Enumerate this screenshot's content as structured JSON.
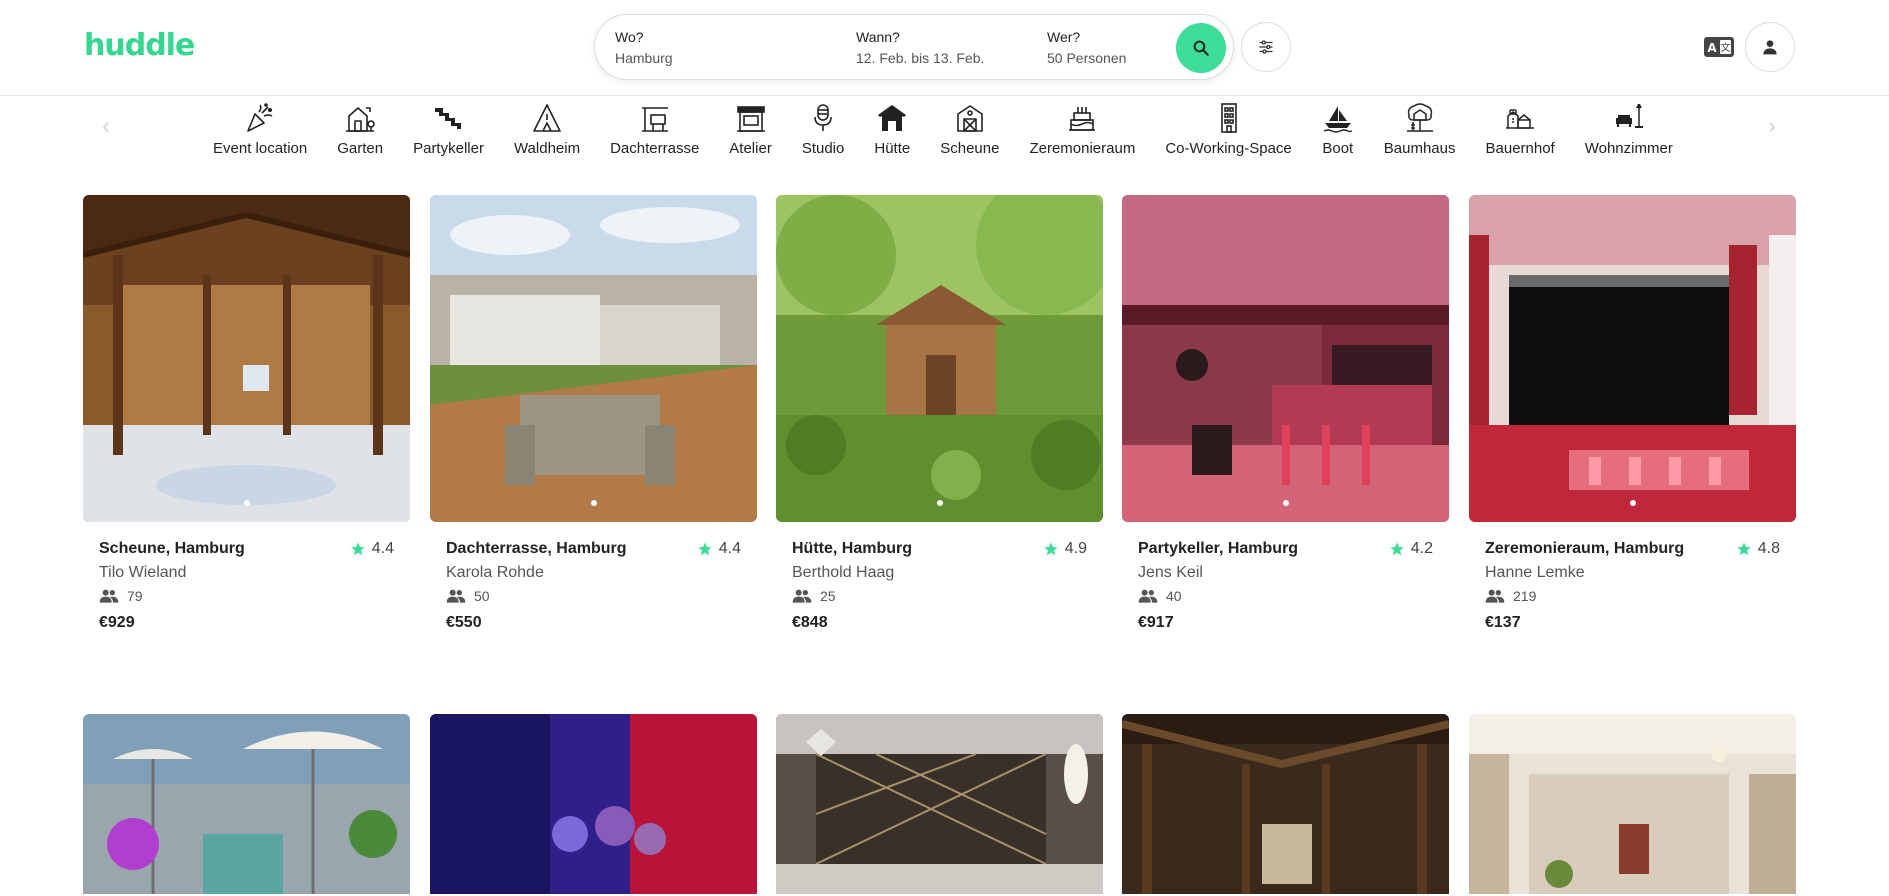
{
  "brand": {
    "logo": "huddle",
    "accent": "#3ddc97"
  },
  "search": {
    "where_label": "Wo?",
    "where_value": "Hamburg",
    "when_label": "Wann?",
    "when_value": "12. Feb. bis 13. Feb.",
    "who_label": "Wer?",
    "who_value": "50 Personen",
    "search_icon": "search-icon",
    "filter_icon": "filter-sliders-icon"
  },
  "header_right": {
    "language_icon": "language-icon",
    "user_icon": "user-icon"
  },
  "categories": [
    {
      "label": "Event location",
      "icon": "party-popper-icon"
    },
    {
      "label": "Garten",
      "icon": "garden-house-icon"
    },
    {
      "label": "Partykeller",
      "icon": "stairs-icon"
    },
    {
      "label": "Waldheim",
      "icon": "forest-cabin-icon"
    },
    {
      "label": "Dachterrasse",
      "icon": "rooftop-icon"
    },
    {
      "label": "Atelier",
      "icon": "atelier-icon"
    },
    {
      "label": "Studio",
      "icon": "microphone-icon"
    },
    {
      "label": "Hütte",
      "icon": "hut-icon"
    },
    {
      "label": "Scheune",
      "icon": "barn-icon"
    },
    {
      "label": "Zeremonieraum",
      "icon": "cake-icon"
    },
    {
      "label": "Co-Working-Space",
      "icon": "office-building-icon"
    },
    {
      "label": "Boot",
      "icon": "boat-icon"
    },
    {
      "label": "Baumhaus",
      "icon": "treehouse-icon"
    },
    {
      "label": "Bauernhof",
      "icon": "farm-icon"
    },
    {
      "label": "Wohnzimmer",
      "icon": "living-room-icon"
    }
  ],
  "listings": [
    {
      "title": "Scheune, Hamburg",
      "rating": "4.4",
      "host": "Tilo Wieland",
      "guests": "79",
      "price": "€929"
    },
    {
      "title": "Dachterrasse, Hamburg",
      "rating": "4.4",
      "host": "Karola Rohde",
      "guests": "50",
      "price": "€550"
    },
    {
      "title": "Hütte, Hamburg",
      "rating": "4.9",
      "host": "Berthold Haag",
      "guests": "25",
      "price": "€848"
    },
    {
      "title": "Partykeller, Hamburg",
      "rating": "4.2",
      "host": "Jens Keil",
      "guests": "40",
      "price": "€917"
    },
    {
      "title": "Zeremonieraum, Hamburg",
      "rating": "4.8",
      "host": "Hanne Lemke",
      "guests": "219",
      "price": "€137"
    }
  ]
}
